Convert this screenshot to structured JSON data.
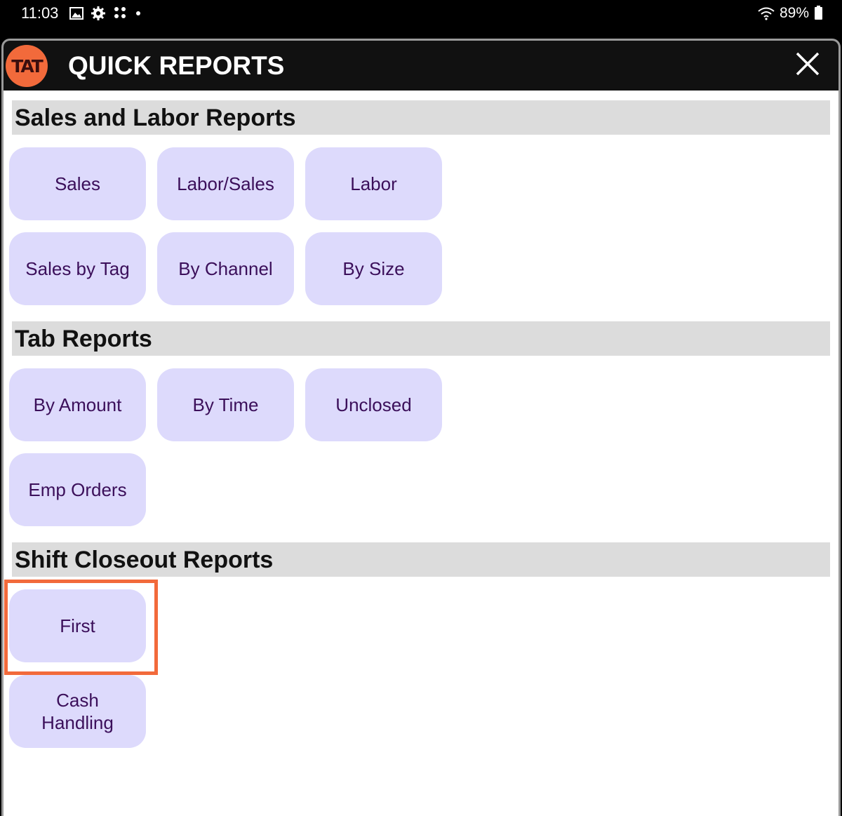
{
  "status_bar": {
    "time": "11:03",
    "battery": "89%",
    "icons": [
      "gallery-icon",
      "settings-gear-icon",
      "app-grid-icon",
      "notification-dot"
    ]
  },
  "dialog": {
    "logo_text": "TAT",
    "title": "QUICK REPORTS",
    "close_icon": "close-icon"
  },
  "sections": [
    {
      "title": "Sales and Labor Reports",
      "buttons": [
        "Sales",
        "Labor/Sales",
        "Labor",
        "Sales by Tag",
        "By Channel",
        "By Size"
      ]
    },
    {
      "title": "Tab Reports",
      "buttons": [
        "By Amount",
        "By Time",
        "Unclosed",
        "Emp Orders"
      ]
    },
    {
      "title": "Shift Closeout Reports",
      "buttons": [
        "First",
        "Cash Handling"
      ]
    }
  ],
  "colors": {
    "accent": "#f26a3b",
    "button_bg": "#dddafc",
    "button_text": "#3b0f5a",
    "section_bg": "#dcdcdc",
    "titlebar_bg": "#111111"
  }
}
